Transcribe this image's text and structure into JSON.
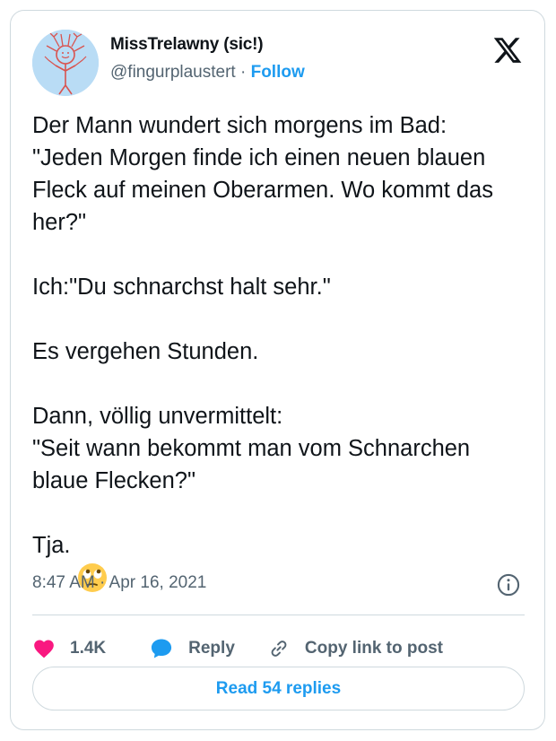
{
  "author": {
    "display_name": "MissTrelawny (sic!)",
    "handle": "@fingurplaustert",
    "separator": "·",
    "follow_label": "Follow"
  },
  "tweet": {
    "paragraphs": [
      "Der Mann wundert sich morgens im Bad:\n\"Jeden Morgen finde ich einen neuen blauen Fleck auf meinen Oberarmen. Wo kommt das her?\"",
      "Ich:\"Du schnarchst halt sehr.\"",
      "Es vergehen Stunden.",
      "Dann, völlig unvermittelt:\n\"Seit wann bekommt man vom Schnarchen blaue Flecken?\""
    ],
    "closing_text": "Tja.",
    "closing_emoji": "face-with-rolling-eyes",
    "timestamp": "8:47 AM · Apr 16, 2021"
  },
  "actions": {
    "like_count": "1.4K",
    "reply_label": "Reply",
    "copy_label": "Copy link to post"
  },
  "replies_button": "Read 54 replies",
  "colors": {
    "accent": "#1d9bf0",
    "like": "#f91880",
    "text": "#0f1419",
    "muted": "#536471",
    "border": "#cfd9de"
  },
  "icons": [
    "x-logo-icon",
    "info-icon",
    "heart-icon",
    "reply-bubble-icon",
    "link-icon"
  ]
}
